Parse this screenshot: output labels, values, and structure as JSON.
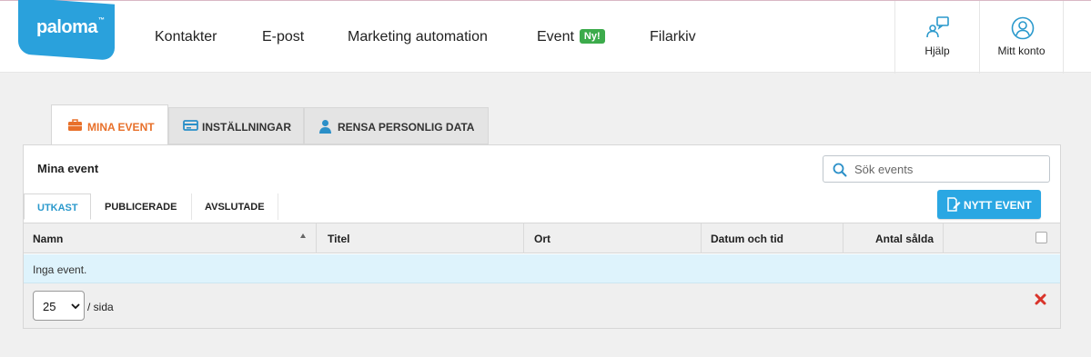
{
  "brand": {
    "name": "paloma",
    "trademark": "™",
    "color": "#2aa1dc"
  },
  "nav": [
    {
      "label": "Kontakter"
    },
    {
      "label": "E-post"
    },
    {
      "label": "Marketing automation"
    },
    {
      "label": "Event",
      "badge": "Ny!"
    },
    {
      "label": "Filarkiv"
    }
  ],
  "topbar_buttons": {
    "help": {
      "label": "Hjälp",
      "icon": "help-chat-icon"
    },
    "account": {
      "label": "Mitt konto",
      "icon": "user-circle-icon"
    }
  },
  "page_tabs": [
    {
      "label": "MINA EVENT",
      "icon": "briefcase-icon",
      "active": true
    },
    {
      "label": "INSTÄLLNINGAR",
      "icon": "card-icon"
    },
    {
      "label": "RENSA PERSONLIG DATA",
      "icon": "person-icon"
    }
  ],
  "panel": {
    "title": "Mina event",
    "search_placeholder": "Sök events",
    "sub_tabs": [
      {
        "label": "UTKAST",
        "active": true
      },
      {
        "label": "PUBLICERADE"
      },
      {
        "label": "AVSLUTADE"
      }
    ],
    "new_button": "NYTT EVENT",
    "columns": [
      "Namn",
      "Titel",
      "Ort",
      "Datum och tid",
      "Antal sålda"
    ],
    "sorted_column": "Namn",
    "empty_message": "Inga event.",
    "page_size": "25",
    "per_page_label": "/ sida"
  },
  "colors": {
    "accent": "#2aa7e3",
    "active_tab": "#e8702a",
    "badge": "#3cab4b",
    "empty_row": "#def3fc",
    "delete": "#d9342b"
  }
}
